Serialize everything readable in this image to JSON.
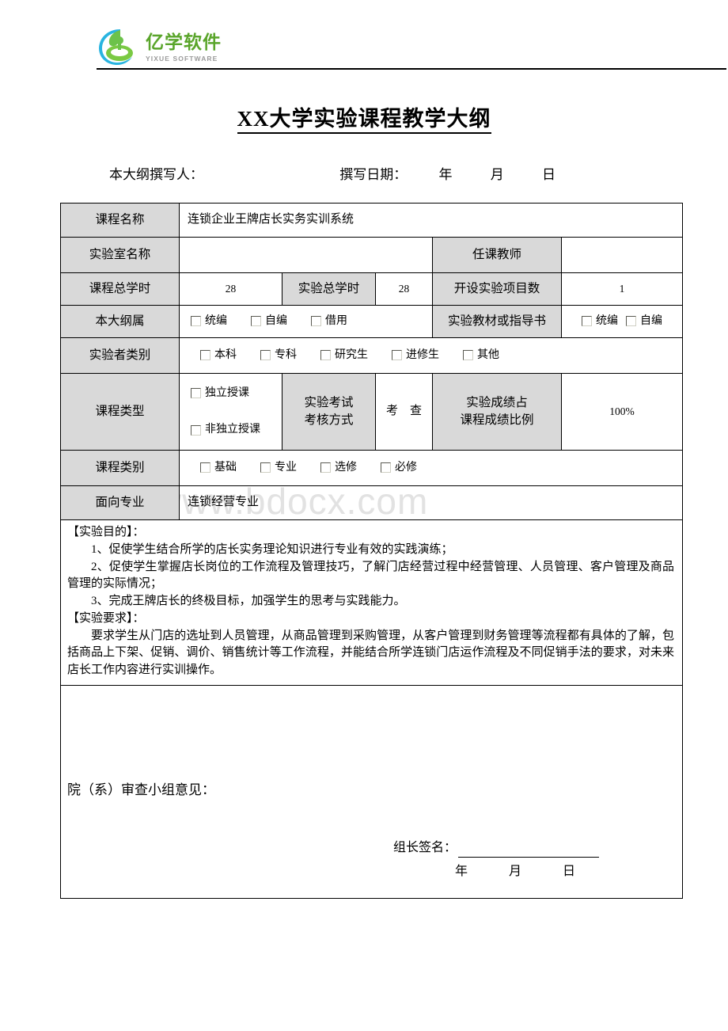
{
  "header": {
    "logo_cn": "亿学软件",
    "logo_en": "YIXUE SOFTWARE"
  },
  "title": "XX大学实验课程教学大纲",
  "writer_line": {
    "author_label": "本大纲撰写人：",
    "date_label": "撰写日期：",
    "year": "年",
    "month": "月",
    "day": "日"
  },
  "watermark": "www.bdocx.com",
  "table": {
    "course_name_label": "课程名称",
    "course_name_value": "连锁企业王牌店长实务实训系统",
    "lab_name_label": "实验室名称",
    "lab_name_value": "",
    "teacher_label": "任课教师",
    "teacher_value": "",
    "total_hours_label": "课程总学时",
    "total_hours_value": "28",
    "exp_hours_label": "实验总学时",
    "exp_hours_value": "28",
    "exp_items_label": "开设实验项目数",
    "exp_items_value": "1",
    "outline_belongs_label": "本大纲属",
    "outline_options": [
      "统编",
      "自编",
      "借用"
    ],
    "textbook_label": "实验教材或指导书",
    "textbook_options": [
      "统编",
      "自编"
    ],
    "experimenter_label": "实验者类别",
    "experimenter_options": [
      "本科",
      "专科",
      "研究生",
      "进修生",
      "其他"
    ],
    "course_type_label": "课程类型",
    "course_type_options": [
      "独立授课",
      "非独立授课"
    ],
    "exam_method_label_line1": "实验考试",
    "exam_method_label_line2": "考核方式",
    "exam_method_value": "考　查",
    "score_ratio_label_line1": "实验成绩占",
    "score_ratio_label_line2": "课程成绩比例",
    "score_ratio_value": "100%",
    "course_category_label": "课程类别",
    "course_category_options": [
      "基础",
      "专业",
      "选修",
      "必修"
    ],
    "major_label": "面向专业",
    "major_value": "连锁经营专业"
  },
  "purpose": {
    "heading": "【实验目的】：",
    "items": [
      "1、促使学生结合所学的店长实务理论知识进行专业有效的实践演练；",
      "2、促使学生掌握店长岗位的工作流程及管理技巧，了解门店经营过程中经营管理、人员管理、客户管理及商品管理的实际情况；",
      "3、完成王牌店长的终极目标，加强学生的思考与实践能力。"
    ]
  },
  "requirement": {
    "heading": "【实验要求】：",
    "text": "要求学生从门店的选址到人员管理，从商品管理到采购管理，从客户管理到财务管理等流程都有具体的了解，包括商品上下架、促销、调价、销售统计等工作流程，并能结合所学连锁门店运作流程及不同促销手法的要求，对未来店长工作内容进行实训操作。"
  },
  "opinion": {
    "label": "院（系）审查小组意见：",
    "signature_label": "组长签名：",
    "year": "年",
    "month": "月",
    "day": "日"
  }
}
